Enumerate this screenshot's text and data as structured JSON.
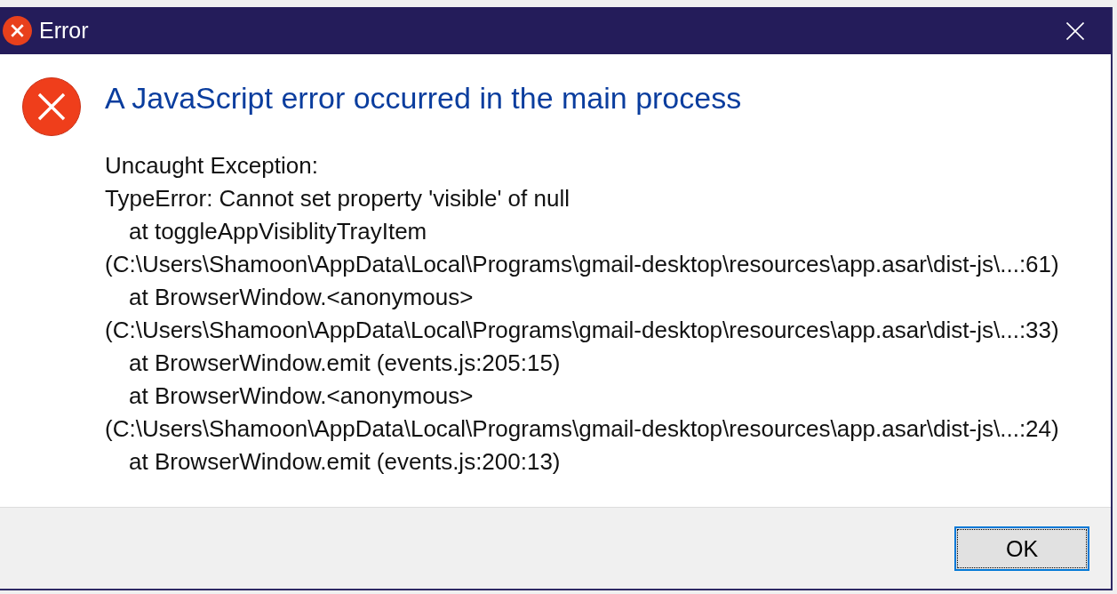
{
  "window": {
    "title": "Error"
  },
  "dialog": {
    "heading": "A JavaScript error occurred in the main process",
    "message_lines": [
      {
        "kind": "plain",
        "text": "Uncaught Exception:"
      },
      {
        "kind": "plain",
        "text": "TypeError: Cannot set property 'visible' of null"
      },
      {
        "kind": "frame",
        "text": "at toggleAppVisiblityTrayItem"
      },
      {
        "kind": "location",
        "text": "(C:\\Users\\Shamoon\\AppData\\Local\\Programs\\gmail-desktop\\resources\\app.asar\\dist-js\\...:61)"
      },
      {
        "kind": "frame",
        "text": "at BrowserWindow.<anonymous>"
      },
      {
        "kind": "location",
        "text": "(C:\\Users\\Shamoon\\AppData\\Local\\Programs\\gmail-desktop\\resources\\app.asar\\dist-js\\...:33)"
      },
      {
        "kind": "frame",
        "text": "at BrowserWindow.emit (events.js:205:15)"
      },
      {
        "kind": "frame",
        "text": "at BrowserWindow.<anonymous>"
      },
      {
        "kind": "location",
        "text": "(C:\\Users\\Shamoon\\AppData\\Local\\Programs\\gmail-desktop\\resources\\app.asar\\dist-js\\...:24)"
      },
      {
        "kind": "frame",
        "text": "at BrowserWindow.emit (events.js:200:13)"
      }
    ]
  },
  "buttons": [
    {
      "label": "OK",
      "focused": true
    }
  ]
}
